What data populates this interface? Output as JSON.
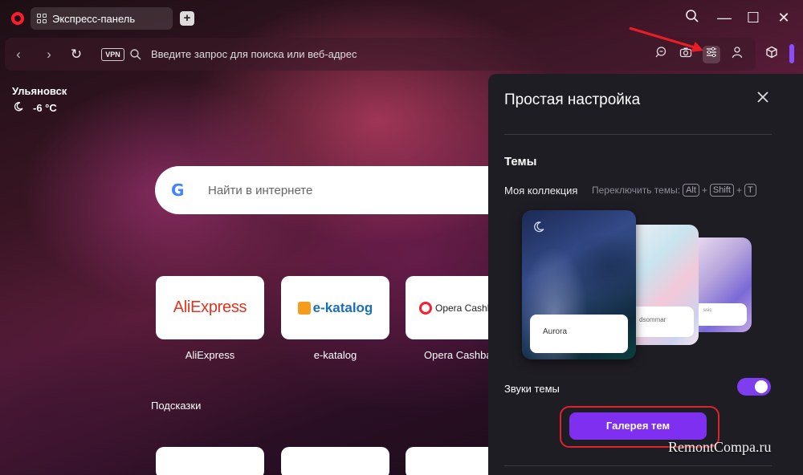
{
  "browser": {
    "tab_title": "Экспресс-панель",
    "new_tab_symbol": "+",
    "controls": {
      "search": "⌕",
      "minimize": "—",
      "maximize": "☐",
      "close": "✕"
    }
  },
  "addressbar": {
    "back_icon": "‹",
    "forward_icon": "›",
    "reload_icon": "↻",
    "vpn_label": "VPN",
    "placeholder": "Введите запрос для поиска или веб-адрес",
    "icons": [
      "lens-icon",
      "camera-icon",
      "easy-setup-icon",
      "profile-icon",
      "extensions-icon"
    ]
  },
  "weather": {
    "city": "Ульяновск",
    "temperature": "-6 °C"
  },
  "search": {
    "placeholder": "Найти в интернете",
    "engine_glyph": "G"
  },
  "speed_dial": {
    "tiles": [
      {
        "label": "AliExpress",
        "logo": "AliExpress"
      },
      {
        "label": "e-katalog",
        "logo": "e-katalog"
      },
      {
        "label": "Opera Cashbac",
        "logo": "Opera Cashback"
      }
    ],
    "hints_label": "Подсказки"
  },
  "easy_setup": {
    "title": "Простая настройка",
    "themes_title": "Темы",
    "collection_label": "Моя коллекция",
    "switch_hint": "Переключить темы:",
    "keys": [
      "Alt",
      "Shift",
      "T"
    ],
    "plus": "+",
    "themes": [
      {
        "name": "Aurora"
      },
      {
        "name": "dsommar"
      },
      {
        "name": "ssic"
      }
    ],
    "sounds_label": "Звуки темы",
    "sounds_enabled": true,
    "gallery_button": "Галерея тем"
  },
  "watermark": "RemontCompa.ru",
  "colors": {
    "accent": "#7e2ff0",
    "highlight_red": "#e0222c",
    "opera_red": "#ff1b2d"
  }
}
